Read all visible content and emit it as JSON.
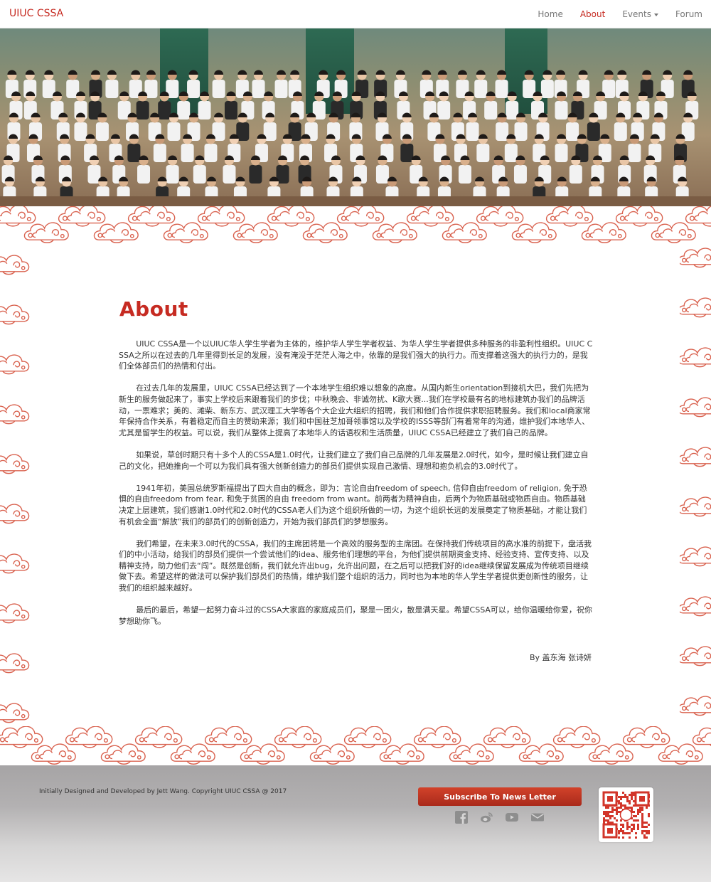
{
  "navbar": {
    "brand": "UIUC CSSA",
    "items": [
      {
        "label": "Home",
        "active": false
      },
      {
        "label": "About",
        "active": true
      },
      {
        "label": "Events",
        "active": false,
        "dropdown": true
      },
      {
        "label": "Forum",
        "active": false
      }
    ]
  },
  "hero": {
    "image": "group-photo"
  },
  "about": {
    "title": "About",
    "paragraphs": [
      "UIUC CSSA是一个以UIUC华人学生学者为主体的，维护华人学生学者权益、为华人学生学者提供多种服务的非盈利性组织。UIUC CSSA之所以在过去的几年里得到长足的发展，没有淹没于茫茫人海之中，依靠的是我们强大的执行力。而支撑着这强大的执行力的，是我们全体部员们的热情和付出。",
      "在过去几年的发展里，UIUC CSSA已经达到了一个本地学生组织难以想象的高度。从国内新生orientation到接机大巴，我们先把为新生的服务做起来了，事实上学校后来跟着我们的步伐；中秋晚会、非诚勿扰、K歌大赛...我们在学校最有名的地标建筑办我们的品牌活动，一票难求；美的、滩柴、新东方、武汉理工大学等各个大企业大组织的招聘，我们和他们合作提供求职招聘服务。我们和local商家常年保持合作关系，有着稳定而自主的赞助来源；我们和中国驻芝加哥领事馆以及学校的ISSS等部门有着常年的沟通，维护我们本地华人、尤其是留学生的权益。可以说，我们从整体上提高了本地华人的话语权和生活质量，UIUC CSSA已经建立了我们自己的品牌。",
      "如果说，草创时期只有十多个人的CSSA是1.0时代，让我们建立了我们自己品牌的几年发展是2.0时代，如今，是时候让我们建立自己的文化，把她推向一个可以为我们具有强大创新创造力的部员们提供实现自己激情、理想和抱负机会的3.0时代了。",
      "1941年初，美国总统罗斯福提出了四大自由的概念，即为：言论自由freedom of speech, 信仰自由freedom of religion, 免于恐惧的自由freedom from fear, 和免于贫困的自由 freedom from want。前两者为精神自由，后两个为物质基础或物质自由。物质基础决定上层建筑，我们感谢1.0时代和2.0时代的CSSA老人们为这个组织所做的一切，为这个组织长远的发展奠定了物质基础，才能让我们有机会全面“解放”我们的部员们的创新创造力，开始为我们部员们的梦想服务。",
      "我们希望，在未来3.0时代的CSSA，我们的主席团将是一个高效的服务型的主席团。在保持我们传统项目的高水准的前提下，盘活我们的中小活动，给我们的部员们提供一个尝试他们的idea、服务他们理想的平台，为他们提供前期资金支持、经验支持、宣传支持、以及精神支持，助力他们去“闯”。既然是创新，我们就允许出bug，允许出问题，在之后可以把我们好的idea继续保留发展成为传统项目继续做下去。希望这样的做法可以保护我们部员们的热情，维护我们整个组织的活力，同时也为本地的华人学生学者提供更创新性的服务，让我们的组织越来越好。",
      "最后的最后，希望一起努力奋斗过的CSSA大家庭的家庭成员们，聚是一团火，散是满天星。希望CSSA可以，给你温暖给你爱，祝你梦想助你飞。"
    ],
    "signature": "By 盖东海 张诗妍"
  },
  "footer": {
    "copyright": "Initially Designed and Developed by Jett Wang. Copyright UIUC CSSA @ 2017",
    "subscribe_label": "Subscribe To News Letter",
    "social_icons": [
      "facebook-icon",
      "weibo-icon",
      "youtube-icon",
      "email-icon"
    ],
    "qr": "wechat-qr-code"
  },
  "colors": {
    "accent": "#c62b22",
    "cloud": "#d9624f"
  }
}
